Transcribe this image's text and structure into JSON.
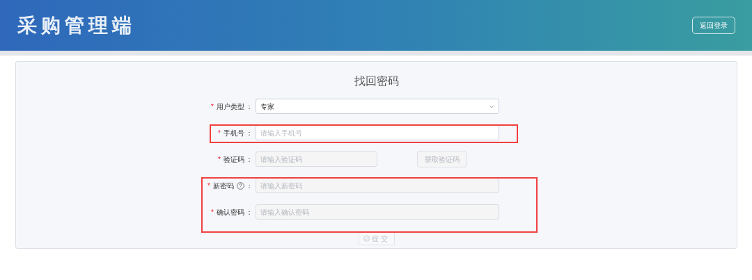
{
  "header": {
    "title": "采购管理端",
    "back_button": "返回登录"
  },
  "form": {
    "title": "找回密码",
    "sections": [
      {
        "highlighted": false,
        "rows": [
          {
            "kind": "select",
            "mark": "*",
            "label": "用户类型",
            "colon": "：",
            "value": "专家",
            "disabled": false
          }
        ]
      },
      {
        "highlighted": true,
        "rows": [
          {
            "kind": "input",
            "mark": "*",
            "label": "手机号",
            "colon": "：",
            "placeholder": "请输入手机号",
            "disabled": false
          }
        ]
      },
      {
        "highlighted": false,
        "rows": [
          {
            "kind": "code",
            "mark": "*",
            "label": "验证码",
            "colon": "：",
            "placeholder": "请输入验证码",
            "disabled": true,
            "button": "获取验证码"
          }
        ]
      },
      {
        "highlighted": true,
        "rows": [
          {
            "kind": "password",
            "mark": "*",
            "label": "新密码",
            "colon": "：",
            "placeholder": "请输入新密码",
            "disabled": true,
            "help": true
          },
          {
            "kind": "password",
            "mark": "*",
            "label": "确认密码",
            "colon": "：",
            "placeholder": "请输入确认密码",
            "disabled": true,
            "help": false
          }
        ]
      }
    ],
    "submit": {
      "label": "提交",
      "disabled": true
    }
  }
}
